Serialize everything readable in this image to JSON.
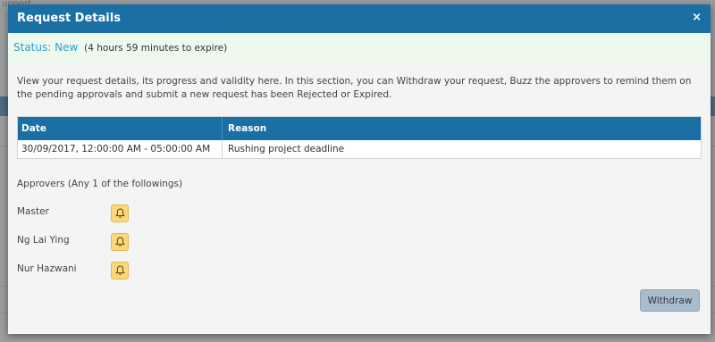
{
  "background": {
    "partial_text": "upport"
  },
  "modal": {
    "title": "Request Details",
    "close_label": "×"
  },
  "status": {
    "label": "Status:",
    "value": "New",
    "expiry": "(4 hours 59 minutes to expire)"
  },
  "description": "View your request details, its progress and validity here. In this section, you can Withdraw your request, Buzz the approvers to remind them on the pending approvals and submit a new request has been Rejected or Expired.",
  "table": {
    "headers": {
      "date": "Date",
      "reason": "Reason"
    },
    "rows": [
      {
        "date": "30/09/2017, 12:00:00 AM - 05:00:00 AM",
        "reason": "Rushing project deadline"
      }
    ]
  },
  "approvers": {
    "title": "Approvers (Any 1 of the followings)",
    "list": [
      {
        "name": "Master",
        "icon": "bell-icon"
      },
      {
        "name": "Ng Lai Ying",
        "icon": "bell-icon"
      },
      {
        "name": "Nur Hazwani",
        "icon": "bell-icon"
      }
    ]
  },
  "actions": {
    "withdraw_label": "Withdraw"
  },
  "colors": {
    "header": "#1a6fa5",
    "status_bg": "#eef9ee",
    "status_text": "#2a9fd6",
    "buzz_button": "#fbd97b",
    "withdraw_button": "#a9bccb"
  }
}
